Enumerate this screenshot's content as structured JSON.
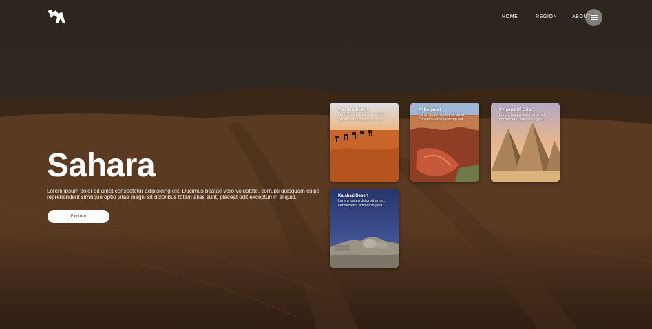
{
  "nav": {
    "home": "HOME",
    "region": "REGION",
    "about": "ABOUT"
  },
  "hero": {
    "title": "Sahara",
    "description": "Lorem ipsum dolor sit amet consectetur adipisicing elit. Ducimus beatae vero voluptate, corrupti quisquam culpa reprehenderit similique optio vitae magni sit doloribus totam alias sunt, placeat odit excepturi in aliquid.",
    "button_label": "Explore"
  },
  "cards": [
    {
      "title": "Western Desert",
      "text": "Lorem ipsum dolor sit amet, consectetur adipisicing elit."
    },
    {
      "title": "Al Begawet",
      "text": "Lorem ipsum dolor sit amet, consectetur adipisicing elit."
    },
    {
      "title": "Pyramid Of Giza",
      "text": "Lorem ipsum dolor sit amet, consectetur adipisicing elit."
    },
    {
      "title": "Kalahari Desert",
      "text": "Lorem ipsum dolor sit amet, consectetur adipisicing elit."
    }
  ],
  "icons": {
    "logo": "camel-logo-icon",
    "menu": "hamburger-menu-icon"
  },
  "colors": {
    "sky": "#2e271f",
    "sand": "#5e3c22",
    "button_bg": "#ffffff"
  }
}
